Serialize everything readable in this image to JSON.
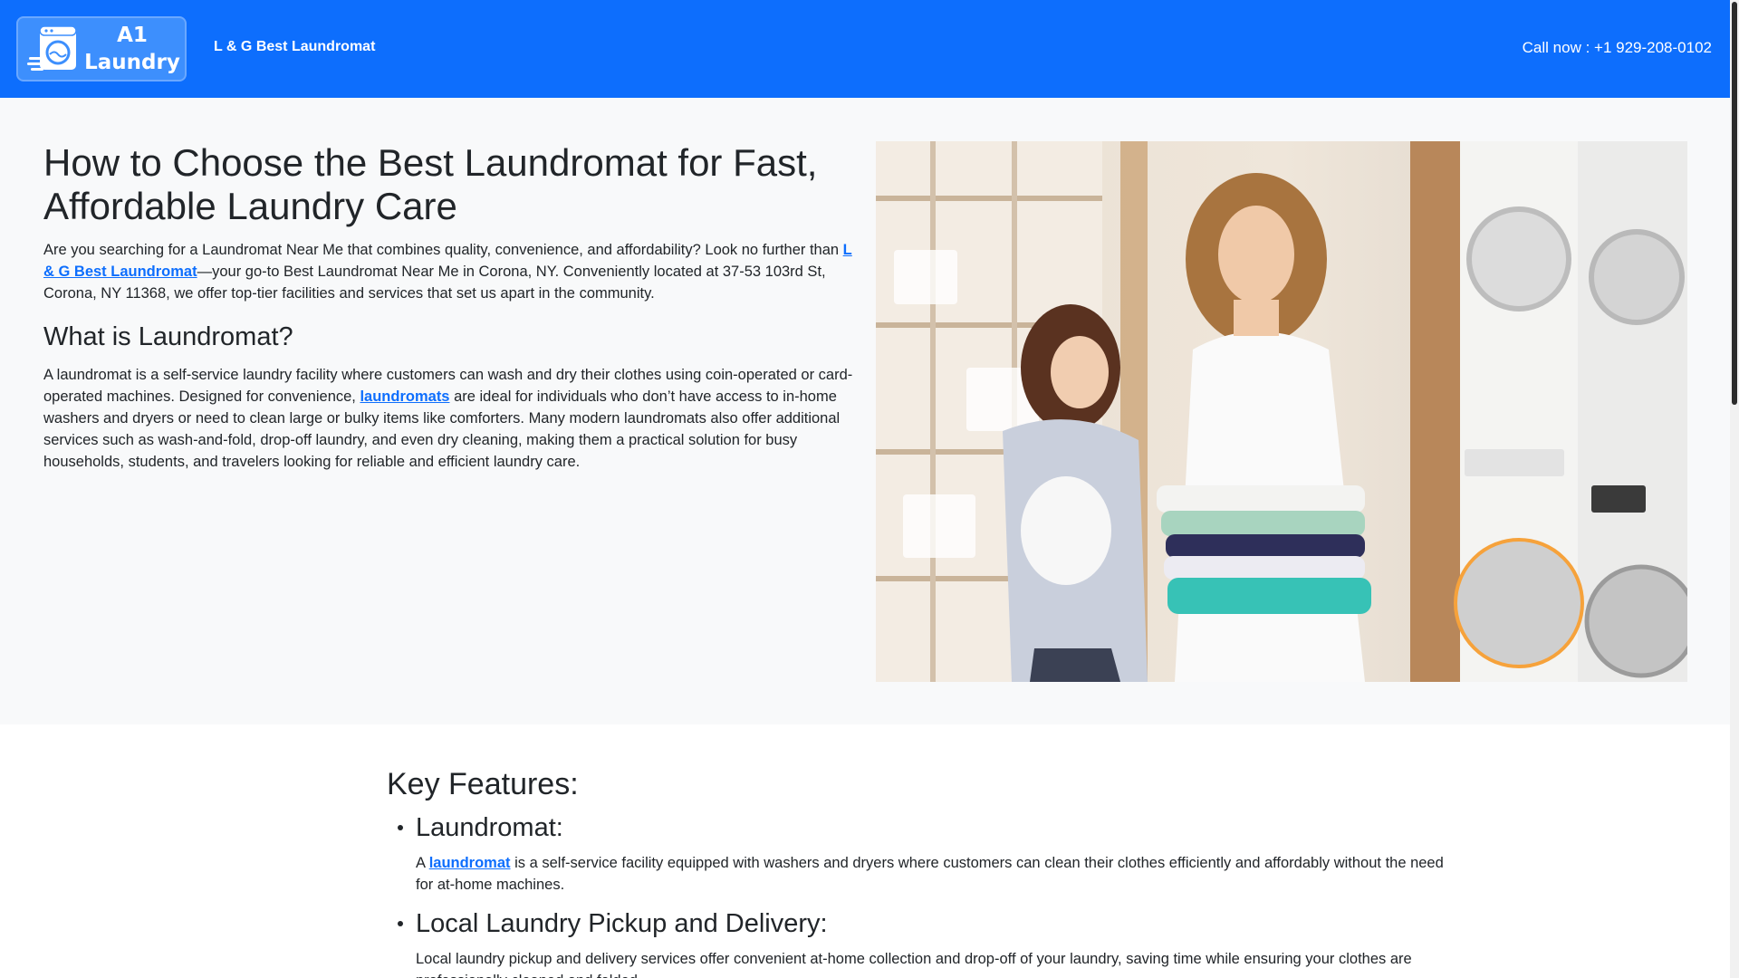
{
  "navbar": {
    "logo_line1": "A1",
    "logo_line2": "Laundry",
    "brand_name": "L & G Best Laundromat",
    "call_now": "Call now : +1 929-208-0102"
  },
  "hero": {
    "title": "How to Choose the Best Laundromat for Fast, Affordable Laundry Care",
    "intro_part1": "Are you searching for a Laundromat Near Me that combines quality, convenience, and affordability? Look no further than ",
    "intro_link": "L & G Best Laundromat",
    "intro_part2": "—your go-to Best Laundromat Near Me in Corona, NY. Conveniently located at 37-53 103rd St, Corona, NY 11368, we offer top-tier facilities and services that set us apart in the community.",
    "section_heading": "What is Laundromat?",
    "section_part1": "A laundromat is a self-service laundry facility where customers can wash and dry their clothes using coin-operated or card-operated machines. Designed for convenience, ",
    "section_link": "laundromats",
    "section_part2": " are ideal for individuals who don’t have access to in-home washers and dryers or need to clean large or bulky items like comforters. Many modern laundromats also offer additional services such as wash-and-fold, drop-off laundry, and even dry cleaning, making them a practical solution for busy households, students, and travelers looking for reliable and efficient laundry care."
  },
  "features": {
    "title": "Key Features:",
    "items": [
      {
        "title": "Laundromat:",
        "desc_part1": "A ",
        "desc_link": "laundromat",
        "desc_part2": " is a self-service facility equipped with washers and dryers where customers can clean their clothes efficiently and affordably without the need for at-home machines."
      },
      {
        "title": "Local Laundry Pickup and Delivery:",
        "desc_part1": "Local laundry pickup and delivery services offer convenient at-home collection and drop-off of your laundry, saving time while ensuring your clothes are professionally cleaned and folded.",
        "desc_link": "",
        "desc_part2": ""
      }
    ]
  },
  "colors": {
    "primary": "#0d6efd",
    "hero_bg": "#f8f9fa",
    "text": "#212529"
  }
}
